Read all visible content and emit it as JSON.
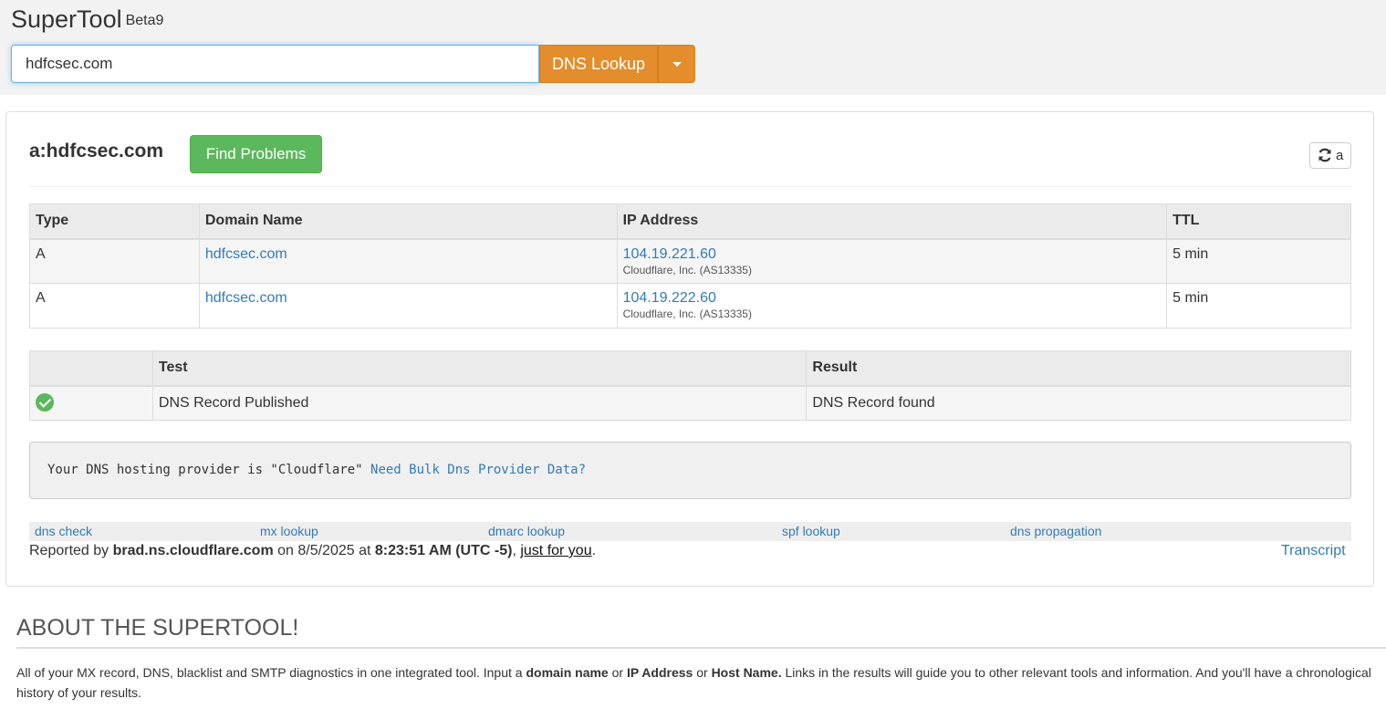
{
  "app": {
    "name": "SuperTool",
    "version": "Beta9"
  },
  "search": {
    "value": "hdfcsec.com",
    "lookup_label": "DNS Lookup"
  },
  "result": {
    "title": "a:hdfcsec.com",
    "find_problems_label": "Find Problems",
    "refresh_label": "a",
    "dns_columns": [
      "Type",
      "Domain Name",
      "IP Address",
      "TTL"
    ],
    "dns_rows": [
      {
        "type": "A",
        "domain": "hdfcsec.com",
        "ip": "104.19.221.60",
        "asn": "Cloudflare, Inc. (AS13335)",
        "ttl": "5 min"
      },
      {
        "type": "A",
        "domain": "hdfcsec.com",
        "ip": "104.19.222.60",
        "asn": "Cloudflare, Inc. (AS13335)",
        "ttl": "5 min"
      }
    ],
    "test_columns": [
      "",
      "Test",
      "Result"
    ],
    "tests": [
      {
        "status": "pass",
        "test": "DNS Record Published",
        "result": "DNS Record found"
      }
    ],
    "provider_text": "Your DNS hosting provider is \"Cloudflare\"",
    "provider_link": "Need Bulk Dns Provider Data?",
    "quick_links": [
      "dns check",
      "mx lookup",
      "dmarc lookup",
      "spf lookup",
      "dns propagation"
    ],
    "reported": {
      "prefix": "Reported by",
      "server": "brad.ns.cloudflare.com",
      "on": "on 8/5/2025 at",
      "time": "8:23:51 AM (UTC -5)",
      "sep": ",",
      "just_for_you": "just for you",
      "end": "."
    },
    "transcript_label": "Transcript"
  },
  "about": {
    "heading": "ABOUT THE SUPERTOOL!",
    "p1": "All of your MX record, DNS, blacklist and SMTP diagnostics in one integrated tool.  Input a",
    "b1": "domain name",
    "p2": "or",
    "b2": "IP Address",
    "p3": "or",
    "b3": "Host Name.",
    "p4": "Links in the results will guide you to other relevant tools and information.  And you'll have a chronological history of your results."
  },
  "colors": {
    "accent_orange": "#e38d2c",
    "success_green": "#5cb85c",
    "link_blue": "#337ab7"
  }
}
